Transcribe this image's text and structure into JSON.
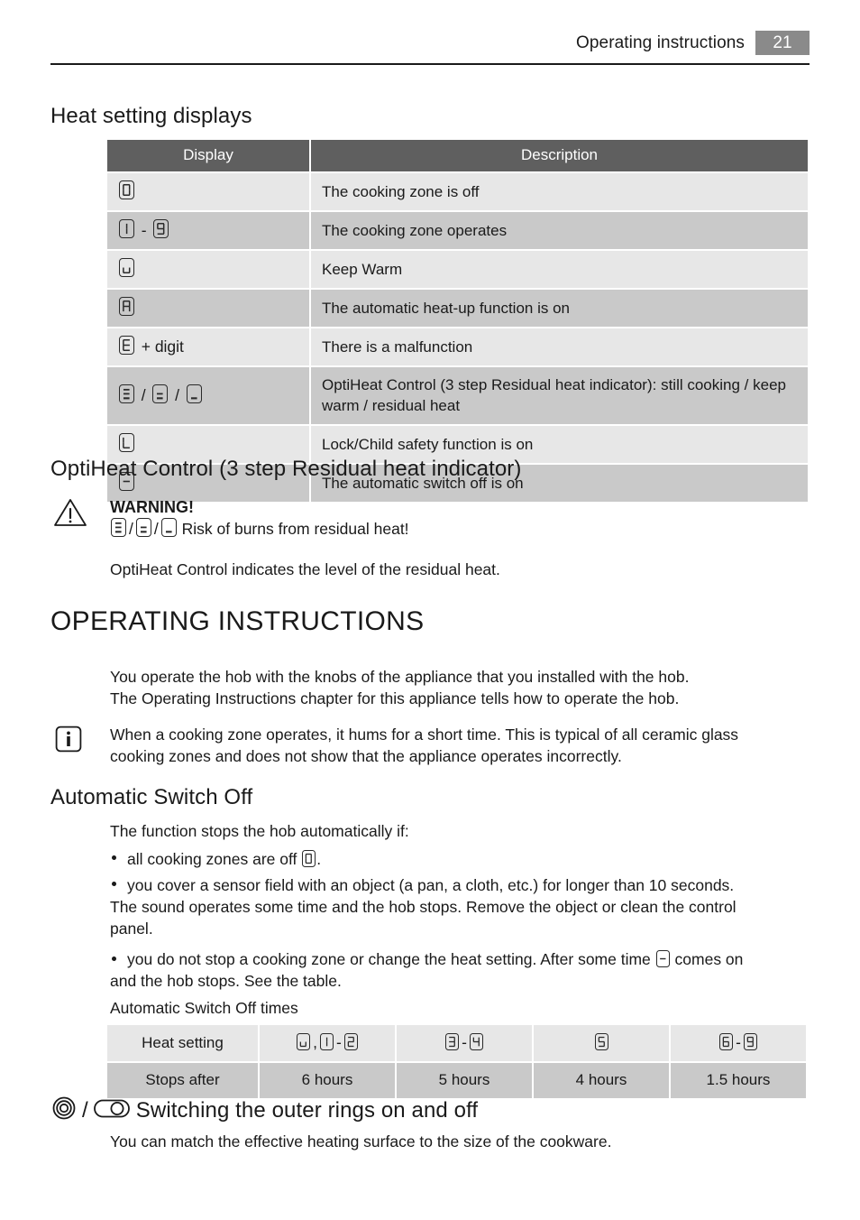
{
  "header": {
    "title": "Operating instructions",
    "page_number": "21"
  },
  "sections": {
    "heat_setting_displays": {
      "heading": "Heat setting displays",
      "table": {
        "columns": [
          "Display",
          "Description"
        ],
        "rows": [
          {
            "display_symbols": [
              "0"
            ],
            "description": "The cooking zone is off"
          },
          {
            "display_symbols": [
              "1",
              "-",
              "9"
            ],
            "description": "The cooking zone operates"
          },
          {
            "display_symbols": [
              "u"
            ],
            "description": "Keep Warm"
          },
          {
            "display_symbols": [
              "A"
            ],
            "description": "The automatic heat-up function is on"
          },
          {
            "display_symbols": [
              "E",
              "+ digit"
            ],
            "description": "There is a malfunction"
          },
          {
            "display_symbols": [
              "H3",
              "/",
              "H2",
              "/",
              "H1"
            ],
            "description": "OptiHeat Control (3 step Residual heat indicator): still cooking / keep warm / residual heat"
          },
          {
            "display_symbols": [
              "L"
            ],
            "description": "Lock/Child safety function is on"
          },
          {
            "display_symbols": [
              "-"
            ],
            "description": "The automatic switch off is on"
          }
        ]
      }
    },
    "optiheat": {
      "heading": "OptiHeat Control (3 step Residual heat indicator)",
      "warning_label": "WARNING!",
      "warning_text": "Risk of burns from residual heat!",
      "body": "OptiHeat Control indicates the level of the residual heat."
    },
    "operating_instructions": {
      "heading": "OPERATING INSTRUCTIONS",
      "paragraph_line1": "You operate the hob with the knobs of the appliance that you installed with the hob.",
      "paragraph_line2": "The Operating Instructions chapter for this appliance tells how to operate the hob.",
      "note_line1": "When a cooking zone operates, it hums for a short time. This is typical of all ceramic glass",
      "note_line2": "cooking zones and does not show that the appliance operates incorrectly."
    },
    "automatic_switch_off": {
      "heading": "Automatic Switch Off",
      "intro": "The function stops the hob automatically if:",
      "bullet1_pre": "all cooking zones are off",
      "bullet1_post": ".",
      "bullet2_line1": "you cover a sensor field with an object (a pan, a cloth, etc.) for longer than 10 seconds.",
      "bullet2_line2": "The sound operates some time and the hob stops. Remove the object or clean the control",
      "bullet2_line3": "panel.",
      "bullet3_pre": "you do not stop a cooking zone or change the heat setting. After some time",
      "bullet3_post": "comes on",
      "bullet3_line2": "and the hob stops. See the table.",
      "table_caption": "Automatic Switch Off times",
      "table": {
        "row_labels": [
          "Heat setting",
          "Stops after"
        ],
        "heat_settings": [
          [
            "u",
            ",",
            "1",
            "-",
            "2"
          ],
          [
            "3",
            "-",
            "4"
          ],
          [
            "5"
          ],
          [
            "6",
            "-",
            "9"
          ]
        ],
        "stops_after": [
          "6 hours",
          "5 hours",
          "4 hours",
          "1.5 hours"
        ]
      }
    },
    "outer_rings": {
      "heading": "Switching the outer rings on and off",
      "separator": "/",
      "body": "You can match the effective heating surface to the size of the cookware."
    }
  },
  "colors": {
    "table_header_bg": "#5f5f5f",
    "row_light": "#e7e7e7",
    "row_dark": "#c9c9c9",
    "page_badge": "#8a8a8a",
    "text": "#1a1a1a"
  }
}
